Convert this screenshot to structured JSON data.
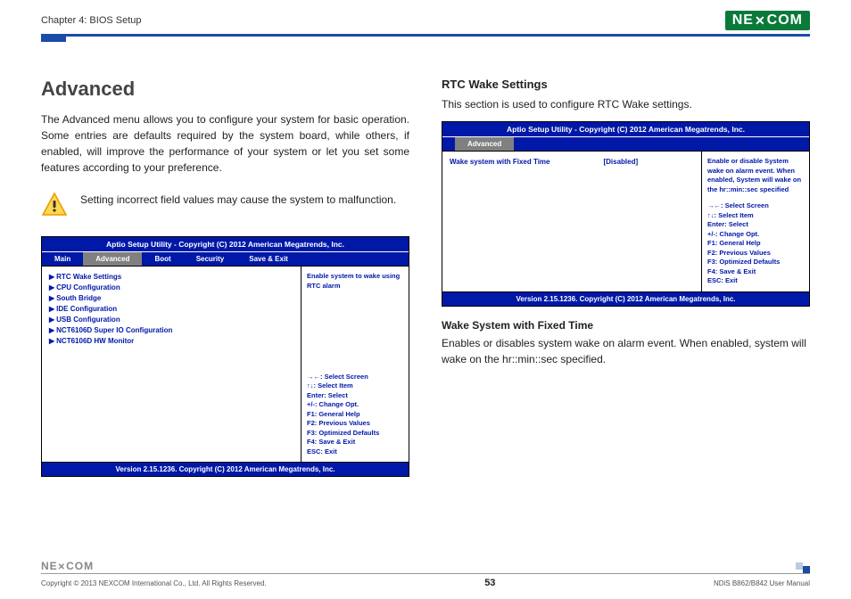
{
  "header": {
    "chapter": "Chapter 4: BIOS Setup",
    "logo": "NE✕COM"
  },
  "left": {
    "title": "Advanced",
    "intro": "The Advanced menu allows you to configure your system for basic operation. Some entries are defaults required by the system board, while others, if enabled, will improve the performance of your system or let you set some features according to your preference.",
    "warning": "Setting incorrect field values may cause the system to malfunction.",
    "bios": {
      "title": "Aptio Setup Utility - Copyright (C) 2012 American Megatrends, Inc.",
      "tabs": [
        "Main",
        "Advanced",
        "Boot",
        "Security",
        "Save & Exit"
      ],
      "active_tab": "Advanced",
      "items": [
        "RTC Wake Settings",
        "CPU Configuration",
        "South Bridge",
        "IDE Configuration",
        "USB Configuration",
        "NCT6106D Super IO Configuration",
        "NCT6106D HW Monitor"
      ],
      "help": "Enable system to wake using RTC alarm",
      "keys": [
        "→←: Select Screen",
        "↑↓: Select Item",
        "Enter: Select",
        "+/-: Change Opt.",
        "F1: General Help",
        "F2: Previous Values",
        "F3: Optimized Defaults",
        "F4: Save & Exit",
        "ESC: Exit"
      ],
      "version": "Version 2.15.1236. Copyright (C) 2012 American Megatrends, Inc."
    }
  },
  "right": {
    "title": "RTC Wake Settings",
    "intro": "This section is used to configure RTC Wake settings.",
    "bios": {
      "title": "Aptio Setup Utility - Copyright (C) 2012 American Megatrends, Inc.",
      "active_tab": "Advanced",
      "setting_label": "Wake system with Fixed Time",
      "setting_value": "[Disabled]",
      "help": "Enable or disable System wake on alarm event. When enabled, System will wake on the hr::min::sec specified",
      "keys": [
        "→←: Select Screen",
        "↑↓: Select Item",
        "Enter: Select",
        "+/-: Change Opt.",
        "F1: General Help",
        "F2: Previous Values",
        "F3: Optimized Defaults",
        "F4: Save & Exit",
        "ESC: Exit"
      ],
      "version": "Version 2.15.1236. Copyright (C) 2012 American Megatrends, Inc."
    },
    "sub_title": "Wake System with Fixed Time",
    "sub_text": "Enables or disables system wake on alarm event. When enabled, system will wake on the hr::min::sec specified."
  },
  "footer": {
    "copyright": "Copyright © 2013 NEXCOM International Co., Ltd. All Rights Reserved.",
    "page": "53",
    "manual": "NDiS B862/B842 User Manual",
    "logo": "NE✕COM"
  }
}
